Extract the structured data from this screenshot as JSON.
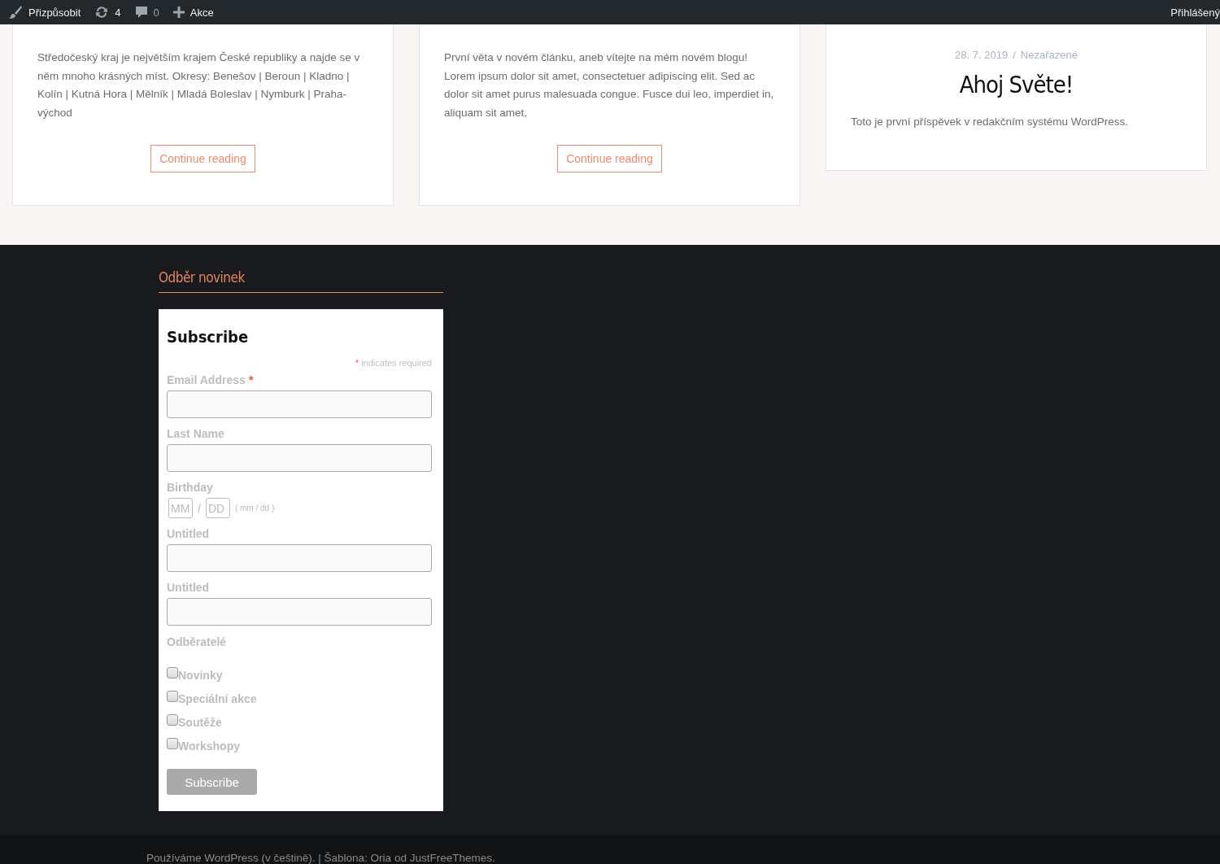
{
  "admin_bar": {
    "items": [
      {
        "kind": "customize",
        "label": "Přizpůsobit"
      },
      {
        "kind": "updates",
        "label": "4"
      },
      {
        "kind": "comments",
        "label": "0"
      },
      {
        "kind": "new",
        "label": "Akce"
      }
    ],
    "account": "Přihlášený"
  },
  "posts": [
    {
      "excerpt": "Středočeský kraj je největším krajem České republiky a najde se v něm mnoho krásných míst. Okresy: Benešov | Beroun | Kladno | Kolín | Kutná Hora | Mělník | Mladá Boleslav | Nymburk | Praha-východ",
      "button": "Continue reading"
    },
    {
      "excerpt": "První věta v novém článku, aneb vítejte na mém novém blogu! Lorem ipsum dolor sit amet, consectetuer adipiscing elit. Sed ac dolor sit amet purus malesuada congue. Fusce dui leo, imperdiet in, aliquam sit amet,",
      "button": "Continue reading"
    },
    {
      "date": "28. 7. 2019",
      "separator": "/",
      "category": "Nezařazené",
      "title": "Ahoj Světe!",
      "excerpt": "Toto je první příspěvek v redakčním systému WordPress."
    }
  ],
  "widget": {
    "title": "Odběr novinek",
    "form": {
      "heading": "Subscribe",
      "required_note": {
        "mark": "*",
        "text": "indicates required"
      },
      "fields": [
        {
          "kind": "text",
          "label": "Email Address",
          "required_mark": "*"
        },
        {
          "kind": "text",
          "label": "Last Name"
        },
        {
          "kind": "date",
          "label": "Birthday",
          "parts": [
            {
              "placeholder": "MM"
            },
            {
              "placeholder": "DD"
            }
          ],
          "separator": "/",
          "hint": "( mm / dd )"
        },
        {
          "kind": "text",
          "label": "Untitled"
        },
        {
          "kind": "text",
          "label": "Untitled"
        }
      ],
      "group": {
        "label": "Odběratelé",
        "options": [
          {
            "label": "Novinky",
            "checked": false
          },
          {
            "label": "Speciální akce",
            "checked": false
          },
          {
            "label": "Soutěže",
            "checked": false
          },
          {
            "label": "Workshopy",
            "checked": false
          }
        ]
      },
      "submit": "Subscribe"
    }
  },
  "footer": "Používáme WordPress (v češtině). | Šablona: Oria od JustFreeThemes."
}
